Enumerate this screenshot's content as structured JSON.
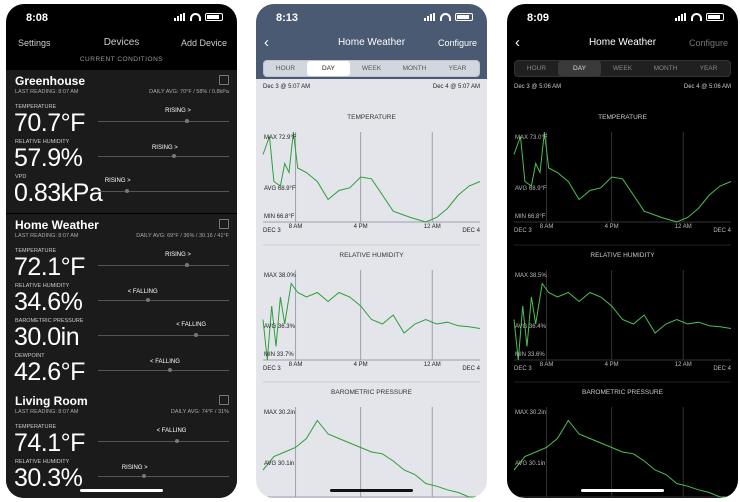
{
  "phone1": {
    "time": "8:08",
    "nav": {
      "left": "Settings",
      "title": "Devices",
      "right": "Add Device"
    },
    "section": "CURRENT CONDITIONS",
    "cards": [
      {
        "name": "Greenhouse",
        "last": "LAST READING: 8:07 AM",
        "avg": "DAILY AVG: 70°F / 58% / 0.8kPa",
        "metrics": [
          {
            "label": "TEMPERATURE",
            "value": "70.7°F",
            "trend": "RISING >",
            "level": 0.68
          },
          {
            "label": "RELATIVE HUMIDITY",
            "value": "57.9%",
            "trend": "RISING >",
            "level": 0.58
          },
          {
            "label": "VPD",
            "value": "0.83kPa",
            "trend": "RISING >",
            "level": 0.22
          }
        ]
      },
      {
        "name": "Home Weather",
        "last": "LAST READING: 8:07 AM",
        "avg": "DAILY AVG: 69°F / 36% / 30.16 / 41°F",
        "metrics": [
          {
            "label": "TEMPERATURE",
            "value": "72.1°F",
            "trend": "RISING >",
            "level": 0.68
          },
          {
            "label": "RELATIVE HUMIDITY",
            "value": "34.6%",
            "trend": "< FALLING",
            "level": 0.38
          },
          {
            "label": "BAROMETRIC PRESSURE",
            "value": "30.0in",
            "trend": "< FALLING",
            "level": 0.75
          },
          {
            "label": "DEWPOINT",
            "value": "42.6°F",
            "trend": "< FALLING",
            "level": 0.55
          }
        ]
      },
      {
        "name": "Living Room",
        "last": "LAST READING: 8:07 AM",
        "avg": "DAILY AVG: 74°F / 31%",
        "metrics": [
          {
            "label": "TEMPERATURE",
            "value": "74.1°F",
            "trend": "< FALLING",
            "level": 0.6
          },
          {
            "label": "RELATIVE HUMIDITY",
            "value": "30.3%",
            "trend": "RISING >",
            "level": 0.35
          }
        ]
      }
    ]
  },
  "phone2": {
    "time": "8:13",
    "title": "Home Weather",
    "configure": "Configure",
    "tabs": [
      "HOUR",
      "DAY",
      "WEEK",
      "MONTH",
      "YEAR"
    ],
    "active_tab": "DAY",
    "range_start": "Dec 3 @ 5:07 AM",
    "range_end": "Dec 4 @ 5:07 AM",
    "charts": [
      {
        "title": "TEMPERATURE",
        "max": "MAX 72.9°F",
        "avg": "AVG 68.9°F",
        "min": "MIN 66.8°F",
        "ticks": [
          "DEC 3",
          "8 AM",
          "4 PM",
          "12 AM",
          "DEC 4"
        ]
      },
      {
        "title": "RELATIVE HUMIDITY",
        "max": "MAX 38.0%",
        "avg": "AVG 36.3%",
        "min": "MIN 33.7%",
        "ticks": [
          "DEC 3",
          "8 AM",
          "4 PM",
          "12 AM",
          "DEC 4"
        ]
      },
      {
        "title": "BAROMETRIC PRESSURE",
        "max": "MAX 30.2in",
        "avg": "AVG 30.1in",
        "min": "",
        "ticks": []
      }
    ]
  },
  "phone3": {
    "time": "8:09",
    "title": "Home Weather",
    "configure": "Configure",
    "tabs": [
      "HOUR",
      "DAY",
      "WEEK",
      "MONTH",
      "YEAR"
    ],
    "active_tab": "DAY",
    "range_start": "Dec 3 @ 5:06 AM",
    "range_end": "Dec 4 @ 5:06 AM",
    "charts": [
      {
        "title": "TEMPERATURE",
        "max": "MAX 73.0°F",
        "avg": "AVG 68.9°F",
        "min": "MIN 66.8°F",
        "ticks": [
          "DEC 3",
          "8 AM",
          "4 PM",
          "12 AM",
          "DEC 4"
        ]
      },
      {
        "title": "RELATIVE HUMIDITY",
        "max": "MAX 38.5%",
        "avg": "AVG 36.4%",
        "min": "MIN 33.6%",
        "ticks": [
          "DEC 3",
          "8 AM",
          "4 PM",
          "12 AM",
          "DEC 4"
        ]
      },
      {
        "title": "BAROMETRIC PRESSURE",
        "max": "MAX 30.2in",
        "avg": "AVG 30.1in",
        "min": "",
        "ticks": []
      }
    ]
  },
  "colors": {
    "line_light": "#2e9e3a",
    "line_dark": "#4cc050",
    "header": "#4a5a72"
  }
}
